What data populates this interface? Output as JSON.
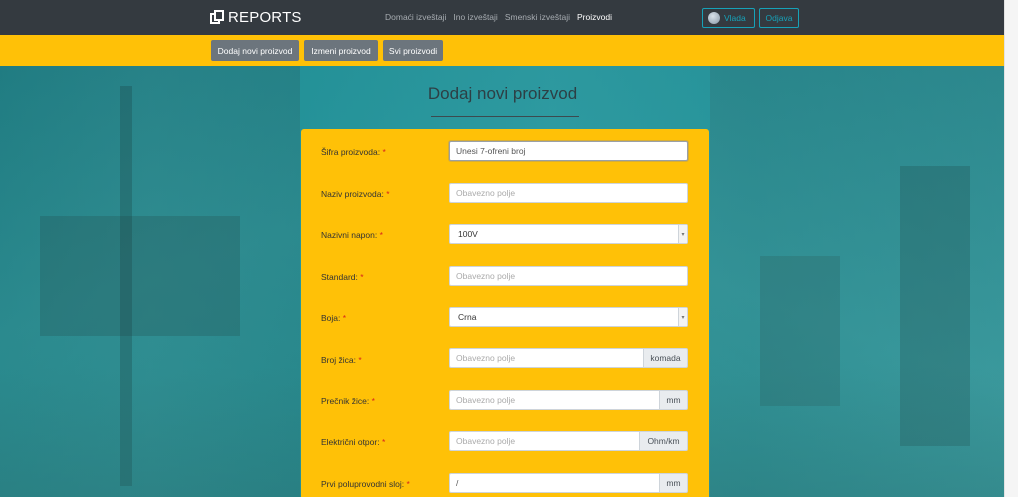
{
  "navbar": {
    "brand": "REPORTS",
    "links": [
      "Domaći izveštaji",
      "Ino izveštaji",
      "Smenski izveštaji",
      "Proizvodi"
    ],
    "user_label": "Vlada",
    "logout_label": "Odjava"
  },
  "subnav": {
    "buttons": [
      "Dodaj novi proizvod",
      "Izmeni proizvod",
      "Svi proizvodi"
    ]
  },
  "form": {
    "title": "Dodaj novi proizvod",
    "fields": [
      {
        "label": "Šifra proizvoda:",
        "required": "*",
        "placeholder": "Unesi 7-ofreni broj"
      },
      {
        "label": "Naziv proizvoda:",
        "required": "*",
        "placeholder": "Obavezno polje"
      },
      {
        "label": "Nazivni napon:",
        "required": "*",
        "value": "100V"
      },
      {
        "label": "Standard:",
        "required": "*",
        "placeholder": "Obavezno polje"
      },
      {
        "label": "Boja:",
        "required": "*",
        "value": "Crna"
      },
      {
        "label": "Broj žica:",
        "required": "*",
        "placeholder": "Obavezno polje",
        "unit": "komada"
      },
      {
        "label": "Prečnik žice:",
        "required": "*",
        "placeholder": "Obavezno polje",
        "unit": "mm"
      },
      {
        "label": "Električni otpor:",
        "required": "*",
        "placeholder": "Obavezno polje",
        "unit": "Ohm/km"
      },
      {
        "label": "Prvi poluprovodni sloj:",
        "required": "*",
        "value": "/",
        "unit": "mm"
      }
    ]
  },
  "colors": {
    "navbar_bg": "#343a40",
    "accent_yellow": "#ffc107",
    "secondary_button": "#6c757d",
    "info": "#17a2b8",
    "required_star": "#d9241c"
  }
}
